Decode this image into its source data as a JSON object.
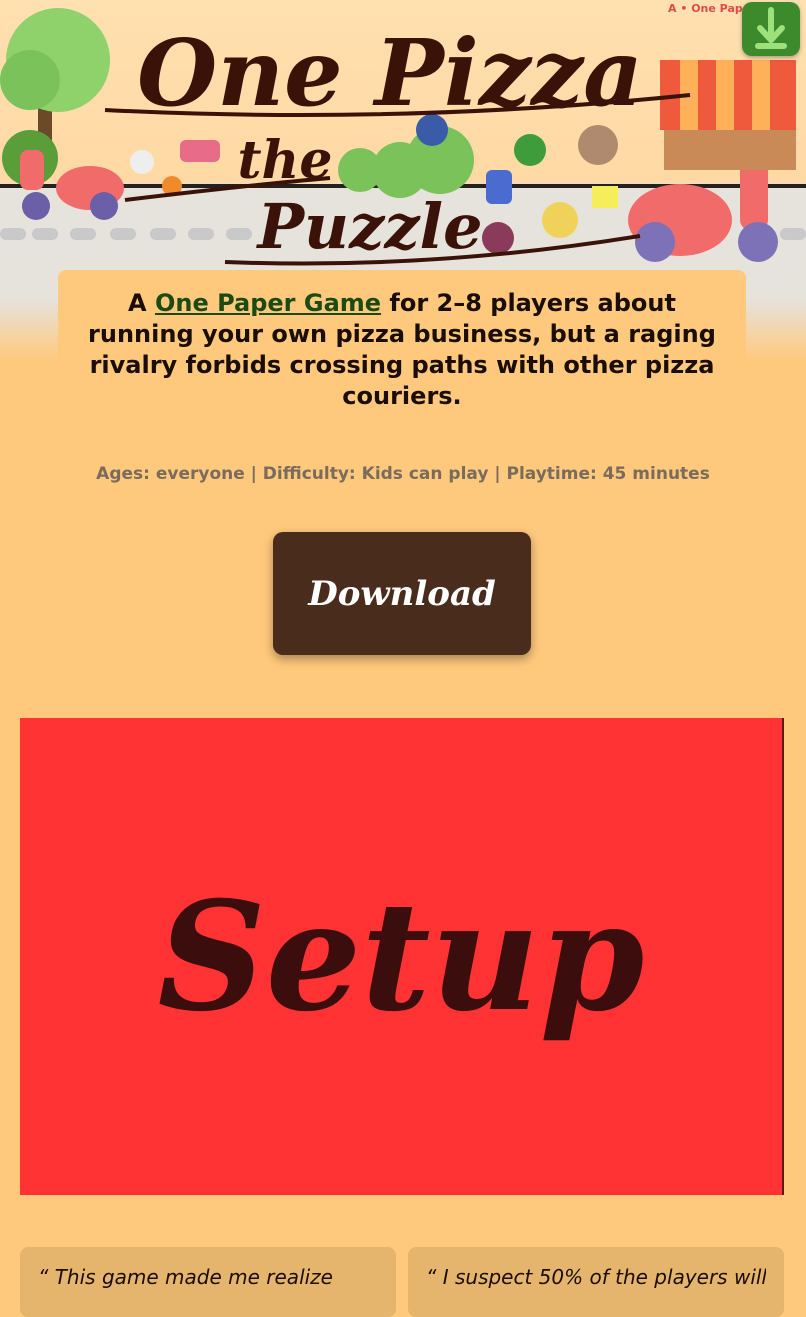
{
  "header": {
    "title_line1": "One Pizza",
    "title_line2": "the",
    "title_line3": "Puzzle",
    "corner_text": "A • One Pap",
    "download_icon": "download-arrow-icon"
  },
  "intro": {
    "prefix": "A ",
    "link": "One Paper Game",
    "suffix": " for 2–8 players about running your own pizza business, but a raging rivalry forbids crossing paths with other pizza couriers."
  },
  "meta": "Ages: everyone | Difficulty: Kids can play | Playtime: 45 minutes",
  "download_label": "Download",
  "video": {
    "label": "Setup",
    "bg_color": "#ff3333"
  },
  "quotes": [
    "“ This game made me realize",
    "“ I suspect 50% of the players will"
  ],
  "colors": {
    "background": "#ffc97d",
    "button": "#4a2c1c",
    "link": "#1b4a12"
  }
}
